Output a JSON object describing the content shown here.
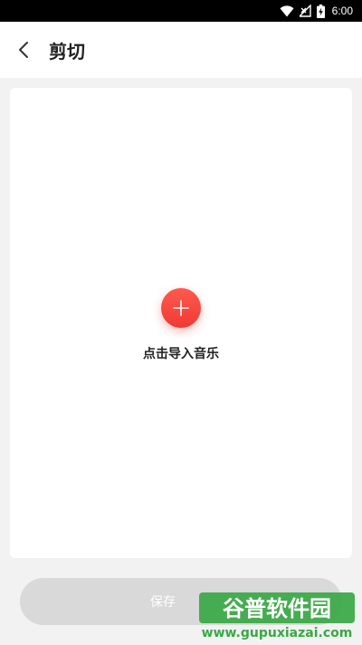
{
  "status_bar": {
    "time": "6:00",
    "icons": [
      "wifi-icon",
      "no-signal-icon",
      "battery-charging-icon"
    ]
  },
  "header": {
    "back_icon": "chevron-left-icon",
    "title": "剪切"
  },
  "main": {
    "add_icon": "plus-icon",
    "import_label": "点击导入音乐"
  },
  "footer": {
    "save_label": "保存"
  },
  "watermark": {
    "brand": "谷普软件园",
    "url": "www.gupuxiazai.com"
  },
  "colors": {
    "accent": "#ef3a34",
    "background": "#f2f2f2",
    "card": "#ffffff",
    "save_disabled": "#d9d9d9",
    "watermark_green": "#3aa845"
  }
}
